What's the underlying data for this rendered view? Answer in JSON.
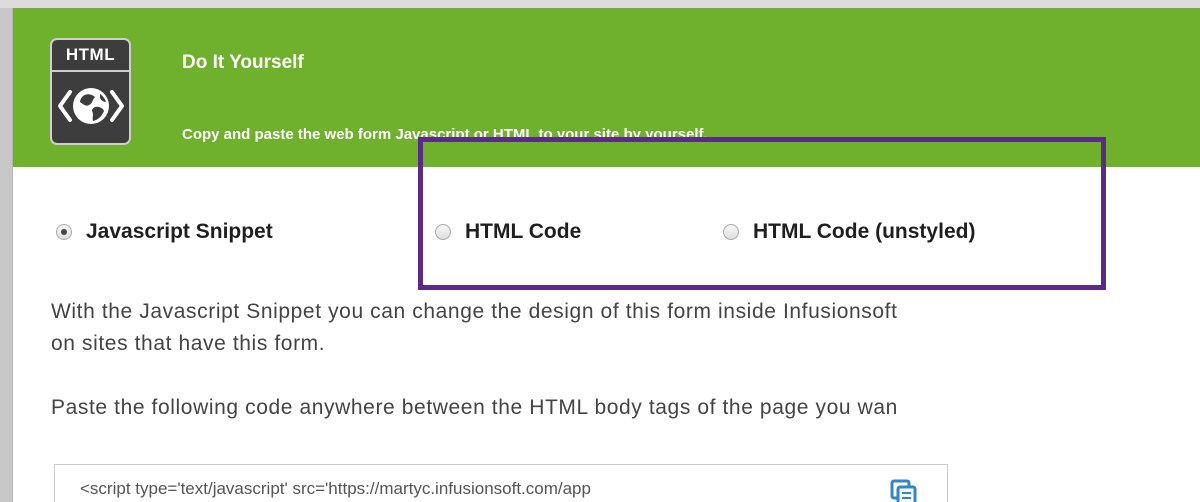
{
  "banner": {
    "icon_name": "html-globe-icon",
    "icon_label": "HTML",
    "title": "Do It Yourself",
    "subtitle": "Copy and paste the web form Javascript or HTML to your site by yourself."
  },
  "colors": {
    "banner_green": "#6fb02c",
    "highlight_purple": "#5b2a86",
    "body_text": "#444444",
    "copy_icon_blue": "#2f86c8"
  },
  "options": [
    {
      "label": "Javascript Snippet",
      "selected": true
    },
    {
      "label": "HTML Code",
      "selected": false
    },
    {
      "label": "HTML Code (unstyled)",
      "selected": false
    }
  ],
  "description": {
    "line1": "With the Javascript Snippet you can change the design of this form inside Infusionsoft",
    "line2": "on sites that have this form.",
    "paste_instruction": "Paste the following code anywhere between the HTML body tags of the page you wan"
  },
  "code_snippet": {
    "value": "<script type='text/javascript' src='https://martyc.infusionsoft.com/app",
    "copy_icon": "copy-icon"
  }
}
